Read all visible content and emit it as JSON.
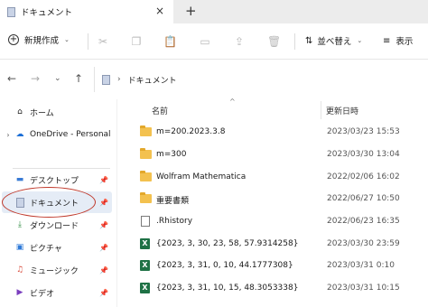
{
  "tab": {
    "title": "ドキュメント",
    "close": "×",
    "new_tab": "+"
  },
  "toolbar": {
    "new_label": "新規作成",
    "sort_label": "並べ替え",
    "view_label": "表示"
  },
  "address": {
    "crumb": "ドキュメント"
  },
  "sidebar": {
    "items": [
      {
        "label": "ホーム",
        "icon": "home-icon",
        "pinned": false
      },
      {
        "label": "OneDrive - Personal",
        "icon": "cloud-icon",
        "pinned": false
      },
      {
        "label": "デスクトップ",
        "icon": "desktop-icon",
        "pinned": true
      },
      {
        "label": "ドキュメント",
        "icon": "documents-icon",
        "pinned": true,
        "selected": true
      },
      {
        "label": "ダウンロード",
        "icon": "download-icon",
        "pinned": true
      },
      {
        "label": "ピクチャ",
        "icon": "pictures-icon",
        "pinned": true
      },
      {
        "label": "ミュージック",
        "icon": "music-icon",
        "pinned": true
      },
      {
        "label": "ビデオ",
        "icon": "video-icon",
        "pinned": true
      }
    ]
  },
  "columns": {
    "name": "名前",
    "date": "更新日時"
  },
  "files": [
    {
      "name": "m=200.2023.3.8",
      "date": "2023/03/23 15:53",
      "type": "folder"
    },
    {
      "name": "m=300",
      "date": "2023/03/30 13:04",
      "type": "folder"
    },
    {
      "name": "Wolfram Mathematica",
      "date": "2022/02/06 16:02",
      "type": "folder"
    },
    {
      "name": "重要書類",
      "date": "2022/06/27 10:50",
      "type": "folder"
    },
    {
      "name": ".Rhistory",
      "date": "2022/06/23 16:35",
      "type": "file"
    },
    {
      "name": "{2023, 3, 30, 23, 58, 57.9314258}",
      "date": "2023/03/30 23:59",
      "type": "excel"
    },
    {
      "name": "{2023, 3, 31, 0, 10, 44.1777308}",
      "date": "2023/03/31 0:10",
      "type": "excel"
    },
    {
      "name": "{2023, 3, 31, 10, 15, 48.3053338}",
      "date": "2023/03/31 10:15",
      "type": "excel"
    }
  ],
  "colors": {
    "selection": "#e5ecf6",
    "annotation": "#c0392b",
    "folder": "#f3c14f",
    "excel": "#1e7145"
  }
}
